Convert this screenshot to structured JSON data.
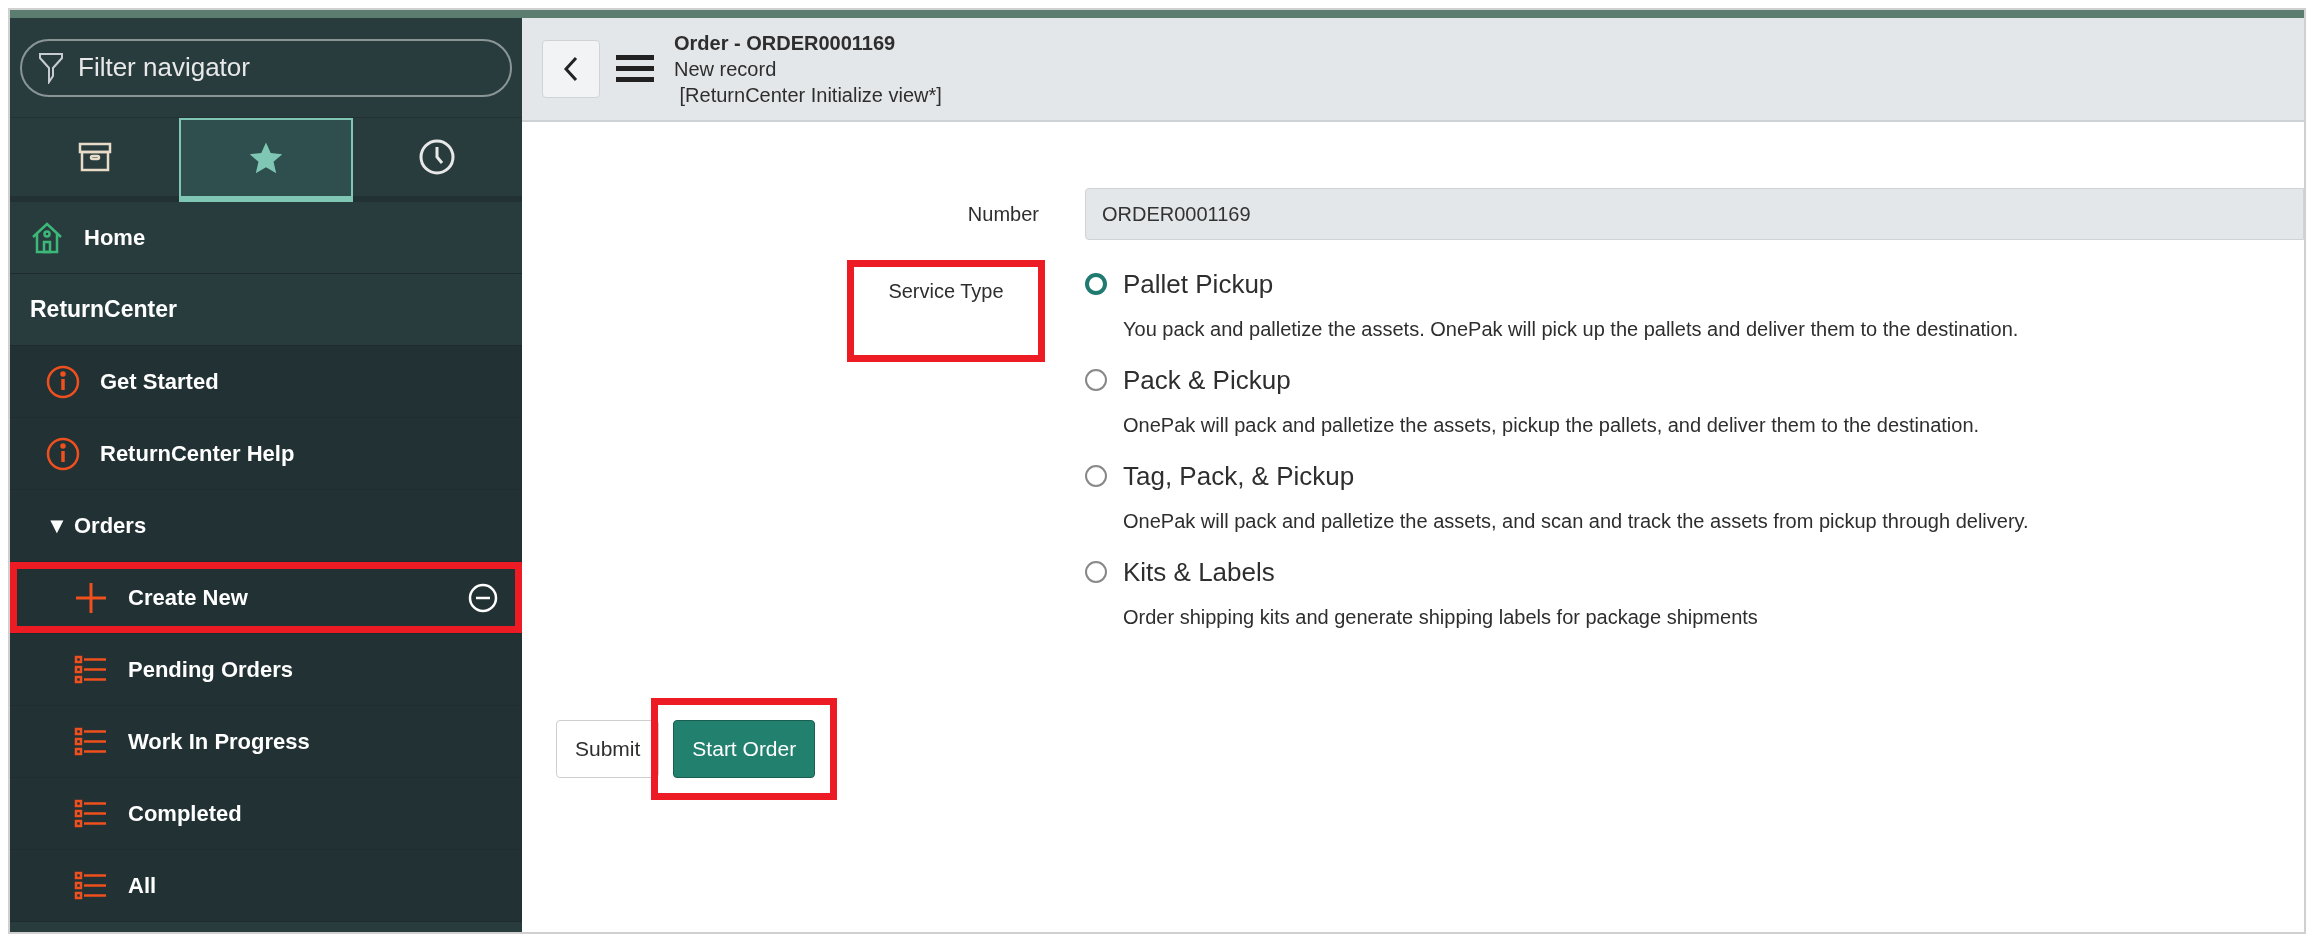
{
  "sidebar": {
    "filter": {
      "placeholder": "Filter navigator"
    },
    "tabs": [
      {
        "selected": false
      },
      {
        "selected": true
      },
      {
        "selected": false
      }
    ],
    "items": [
      {
        "kind": "home",
        "label": "Home",
        "highlighted": false
      },
      {
        "kind": "section",
        "label": "ReturnCenter",
        "highlighted": false
      },
      {
        "kind": "info",
        "label": "Get Started",
        "highlighted": false
      },
      {
        "kind": "info",
        "label": "ReturnCenter Help",
        "highlighted": false
      },
      {
        "kind": "group",
        "caret": "▼",
        "label": "Orders",
        "highlighted": false,
        "children": [
          {
            "kind": "create",
            "label": "Create New",
            "highlighted": true
          },
          {
            "kind": "list",
            "label": "Pending Orders",
            "highlighted": false
          },
          {
            "kind": "list",
            "label": "Work In Progress",
            "highlighted": false
          },
          {
            "kind": "list",
            "label": "Completed",
            "highlighted": false
          },
          {
            "kind": "list",
            "label": "All",
            "highlighted": false
          }
        ]
      }
    ]
  },
  "header": {
    "title": "Order - ORDER0001169",
    "subtitle": "New record",
    "view": " [ReturnCenter Initialize view*]"
  },
  "form": {
    "number": {
      "label": "Number",
      "value": "ORDER0001169",
      "highlighted": false
    },
    "service_type": {
      "label": "Service Type",
      "highlighted": true,
      "options": [
        {
          "label": "Pallet Pickup",
          "description": "You pack and palletize the assets. OnePak will pick up the pallets and deliver them to the destination.",
          "focused": true
        },
        {
          "label": "Pack & Pickup",
          "description": "OnePak will pack and palletize the assets, pickup the pallets, and deliver them to the destination.",
          "focused": false
        },
        {
          "label": "Tag, Pack, & Pickup",
          "description": "OnePak will pack and palletize the assets, and scan and track the assets from pickup through delivery.",
          "focused": false
        },
        {
          "label": "Kits & Labels",
          "description": "Order shipping kits and generate shipping labels for package shipments",
          "focused": false
        }
      ]
    }
  },
  "buttons": [
    {
      "label": "Submit",
      "kind": "secondary",
      "highlighted": false
    },
    {
      "label": "Start Order",
      "kind": "primary",
      "highlighted": true
    }
  ]
}
